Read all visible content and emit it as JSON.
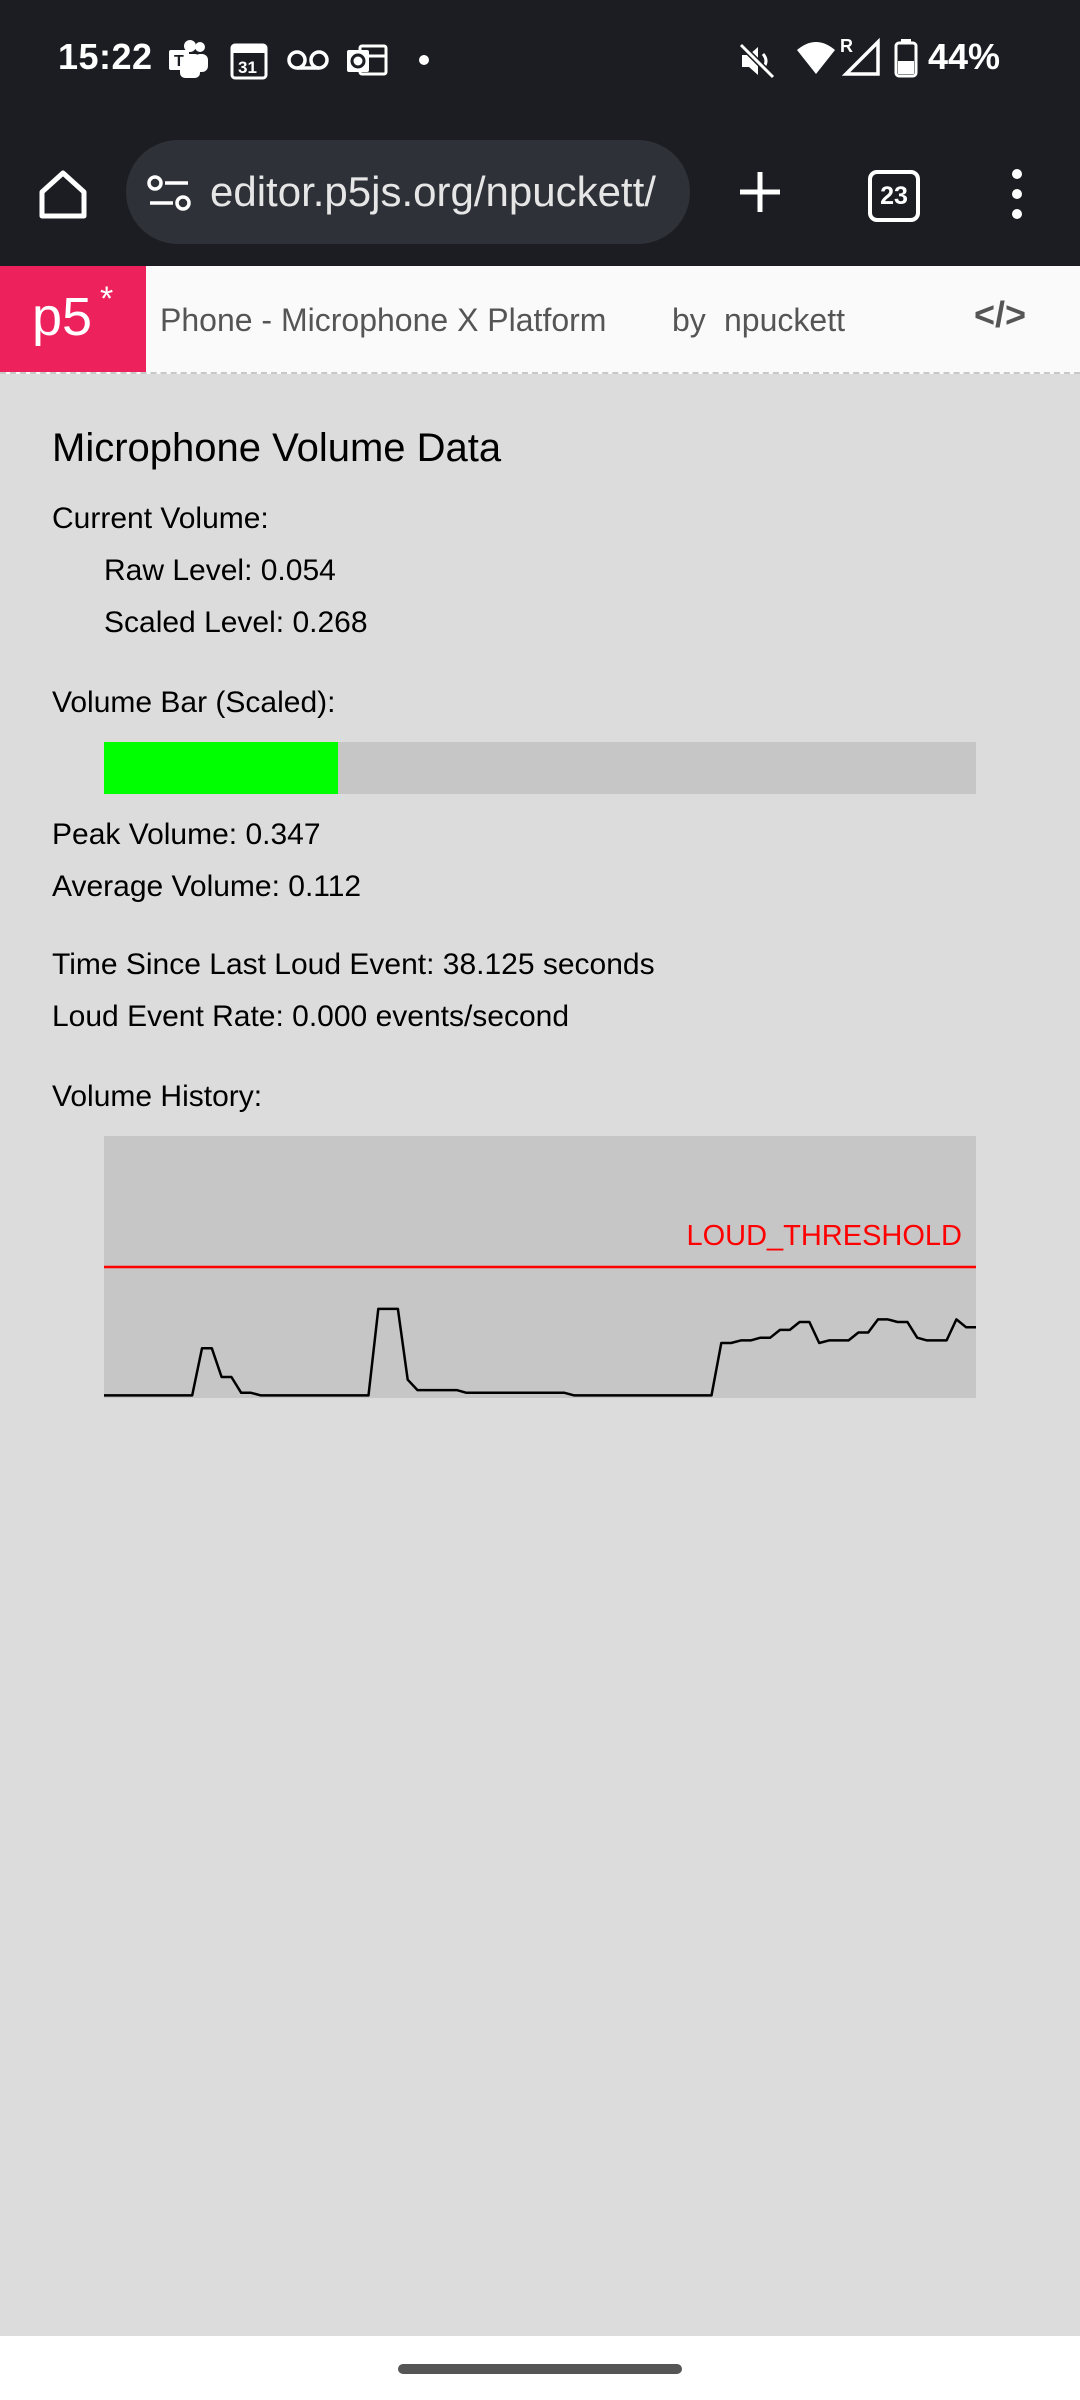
{
  "status_bar": {
    "time": "15:22",
    "notification_icons": [
      "teams-icon",
      "calendar-icon",
      "voicemail-icon",
      "outlook-icon",
      "more-dot-icon"
    ],
    "calendar_day": "31",
    "right_icons": [
      "mute-icon",
      "wifi-icon",
      "signal-icon",
      "battery-icon"
    ],
    "signal_roaming": "R",
    "battery_percent": "44%",
    "battery_level": 0.44
  },
  "browser": {
    "url": "editor.p5js.org/npuckett/",
    "tab_count": "23",
    "icons": [
      "home-icon",
      "site-settings-icon",
      "new-tab-icon",
      "tab-switcher-icon",
      "menu-icon"
    ]
  },
  "p5_header": {
    "logo_text": "p5",
    "logo_star": "*",
    "sketch_title": "Phone - Microphone X Platform",
    "by_label": "by",
    "author": "npuckett",
    "code_toggle_icon": "code-icon",
    "code_toggle_glyph": "</>"
  },
  "sketch": {
    "title": "Microphone Volume Data",
    "current_volume_label": "Current Volume:",
    "raw_level": "Raw Level: 0.054",
    "scaled_level": "Scaled Level: 0.268",
    "volume_bar_label": "Volume Bar (Scaled):",
    "volume_bar_value": 0.268,
    "peak_volume": "Peak Volume: 0.347",
    "average_volume": "Average Volume: 0.112",
    "time_since_loud": "Time Since Last Loud Event: 38.125 seconds",
    "loud_event_rate": "Loud Event Rate: 0.000 events/second",
    "history_label": "Volume History:",
    "threshold_label": "LOUD_THRESHOLD",
    "colors": {
      "bar_fill": "#00ff00",
      "threshold": "#ff0000",
      "history_line": "#000000",
      "canvas_bg": "#dcdcdc",
      "panel_bg": "#c6c6c6",
      "p5_pink": "#ed225d"
    }
  },
  "chart_data": {
    "type": "line",
    "title": "Volume History:",
    "xlabel": "",
    "ylabel": "",
    "ylim": [
      0,
      1
    ],
    "threshold": 0.5,
    "threshold_label": "LOUD_THRESHOLD",
    "grid": false,
    "series": [
      {
        "values": [
          0.01,
          0.01,
          0.01,
          0.01,
          0.01,
          0.01,
          0.01,
          0.01,
          0.01,
          0.01,
          0.19,
          0.19,
          0.08,
          0.08,
          0.02,
          0.02,
          0.01,
          0.01,
          0.01,
          0.01,
          0.01,
          0.01,
          0.01,
          0.01,
          0.01,
          0.01,
          0.01,
          0.01,
          0.34,
          0.34,
          0.34,
          0.07,
          0.03,
          0.03,
          0.03,
          0.03,
          0.03,
          0.02,
          0.02,
          0.02,
          0.02,
          0.02,
          0.02,
          0.02,
          0.02,
          0.02,
          0.02,
          0.02,
          0.01,
          0.01,
          0.01,
          0.01,
          0.01,
          0.01,
          0.01,
          0.01,
          0.01,
          0.01,
          0.01,
          0.01,
          0.01,
          0.01,
          0.01,
          0.21,
          0.21,
          0.22,
          0.22,
          0.23,
          0.23,
          0.26,
          0.26,
          0.29,
          0.29,
          0.21,
          0.22,
          0.22,
          0.22,
          0.25,
          0.25,
          0.3,
          0.3,
          0.29,
          0.29,
          0.23,
          0.22,
          0.22,
          0.22,
          0.3,
          0.27,
          0.27
        ]
      }
    ]
  }
}
